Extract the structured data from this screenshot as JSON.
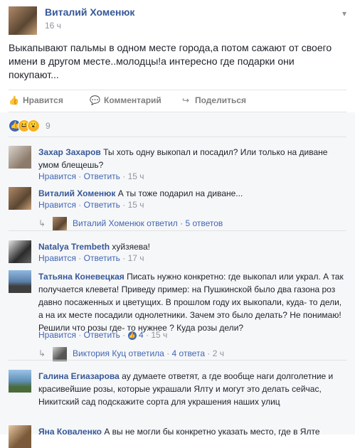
{
  "post": {
    "author": "Виталий Хоменюк",
    "time": "16 ч",
    "text": "Выкапывают пальмы в одном месте города,а потом сажают от своего имени в другом месте..молодцы!а интересно где подарки они покупают..."
  },
  "actions": {
    "like": "Нравится",
    "comment": "Комментарий",
    "share": "Поделиться"
  },
  "reactions": {
    "count": "9"
  },
  "labels": {
    "like": "Нравится",
    "reply": "Ответить",
    "dot": "·"
  },
  "comments": [
    {
      "author": "Захар Захаров",
      "text": "Ты хоть одну выкопал и посадил? Или только на диване умом блещешь?",
      "time": "15 ч"
    },
    {
      "author": "Виталий Хоменюк",
      "text": "А ты тоже подарил на диване...",
      "time": "15 ч",
      "replies": "Виталий Хоменюк ответил · 5 ответов"
    },
    {
      "author": "Natalya Trembeth",
      "text": "хуйзяева!",
      "time": "17 ч"
    },
    {
      "author": "Татьяна Коневецкая",
      "text": "Писать нужно конкретно: где выкопал или украл. А так получается клевета! Приведу пример: на Пушкинской было два газона роз давно посаженных и цветущих. В прошлом году их выкопали, куда- то дели, а на их месте посадили однолетники. Зачем это было делать? Не понимаю! Решили что розы где- то нужнее ? Куда розы дели?",
      "time": "15 ч",
      "likes": "4",
      "replies_author": "Виктория Куц ответила",
      "replies_count": "4 ответа",
      "replies_time": "2 ч"
    },
    {
      "author": "Галина Егиазарова",
      "text": "ау думаете ответят, а где вообще наги долголетние и красивейшие розы, которые украшали Ялту и могут это делать сейчас, Никитский сад подскажите сорта для украшения наших улиц"
    },
    {
      "author": "Яна Коваленко",
      "text": "А вы не могли бы конкретно указать место, где в Ялте"
    }
  ]
}
